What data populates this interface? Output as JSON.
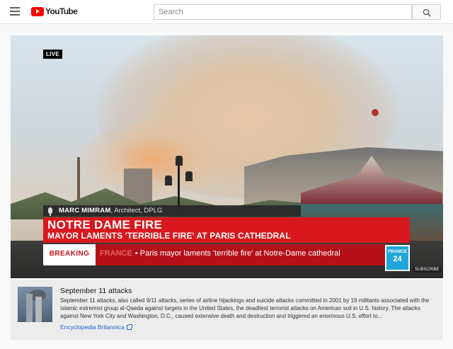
{
  "header": {
    "logo_text": "YouTube",
    "search_placeholder": "Search",
    "icons": [
      "menu-icon",
      "youtube-logo-icon",
      "search-icon"
    ]
  },
  "video": {
    "live_badge": "LIVE",
    "speaker_name": "MARC MIMRAM",
    "speaker_role": ", Architect, DPLG",
    "headline_main": "NOTRE DAME FIRE",
    "headline_sub": "MAYOR LAMENTS 'TERRIBLE FIRE' AT PARIS CATHEDRAL",
    "breaking_label": "BREAKING",
    "ticker_country": "FRANCE",
    "ticker_text": "• Paris mayor laments 'terrible fire' at Notre-Dame cathedral",
    "channel_logo_top": "FRANCE",
    "channel_logo_bottom": "24",
    "subscribe_label": "SUBSCRIBE",
    "colors": {
      "headline_red": "#d8181e",
      "breaking_red": "#b5111a",
      "channel_blue": "#1fa7d9"
    }
  },
  "info_panel": {
    "title": "September 11 attacks",
    "description": "September 11 attacks, also called 9/11 attacks, series of airline hijackings and suicide attacks committed in 2001 by 19 militants associated with the Islamic extremist group al-Qaeda against targets in the United States, the deadliest terrorist attacks on American soil in U.S. history. The attacks against New York City and Washington, D.C., caused extensive death and destruction and triggered an enormous U.S. effort to...",
    "source_link": "Encyclopedia Britannica",
    "link_icon": "external-link-icon"
  }
}
